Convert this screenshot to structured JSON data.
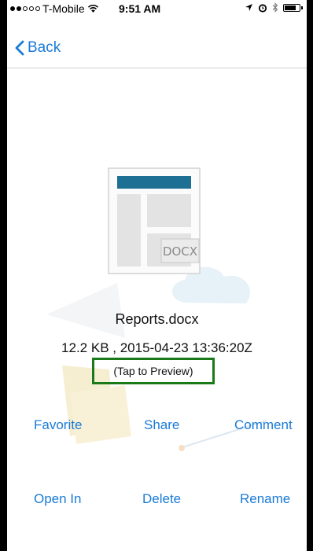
{
  "status_bar": {
    "carrier": "T-Mobile",
    "time": "9:51 AM",
    "signal_filled": 2,
    "signal_total": 5,
    "icons": [
      "wifi-icon",
      "location-arrow-icon",
      "alarm-icon",
      "bluetooth-icon",
      "battery-icon"
    ],
    "battery_level": 0.8
  },
  "nav": {
    "back_label": "Back"
  },
  "file": {
    "icon_badge": "DOCX",
    "name": "Reports.docx",
    "meta": "12.2 KB , 2015-04-23 13:36:20Z",
    "preview_label": "(Tap to Preview)"
  },
  "actions": {
    "favorite": "Favorite",
    "share": "Share",
    "comment": "Comment",
    "open_in": "Open In",
    "delete": "Delete",
    "rename": "Rename"
  },
  "colors": {
    "accent": "#1a7bd8",
    "highlight": "#1a7a1a",
    "doc_bar": "#1e6f94"
  }
}
